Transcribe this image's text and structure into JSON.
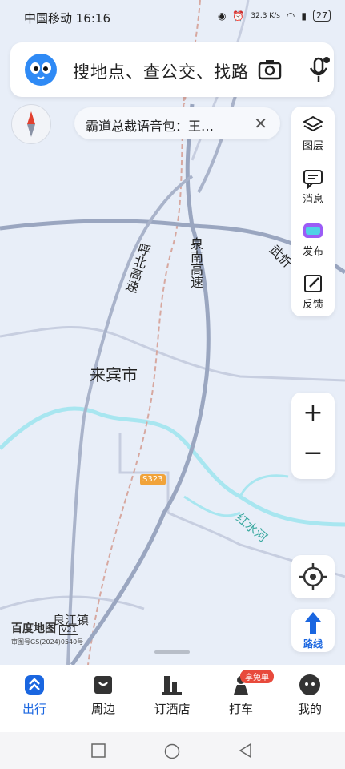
{
  "status": {
    "carrier_time": "中国移动 16:16",
    "net_speed": "32.3 K/s",
    "battery": "27"
  },
  "search": {
    "placeholder": "搜地点、查公交、找路"
  },
  "banner": {
    "text": "霸道总裁语音包：王…"
  },
  "side_tools": [
    {
      "label": "图层",
      "icon": "layers-icon"
    },
    {
      "label": "消息",
      "icon": "message-icon"
    },
    {
      "label": "发布",
      "icon": "publish-icon"
    },
    {
      "label": "反馈",
      "icon": "feedback-icon"
    }
  ],
  "map": {
    "labels": {
      "city": "来宾市",
      "highway_1": "呼北高速",
      "highway_2": "泉南高速",
      "highway_3": "武忻",
      "road_badge": "S323",
      "river": "红水河",
      "town": "良江镇"
    },
    "water_color": "#a8e6f0",
    "road_color": "#9aa6c0"
  },
  "route_label": "路线",
  "brand": {
    "name": "百度地图",
    "version": "V21",
    "review": "审图号GS(2024)0540号"
  },
  "tabs": [
    {
      "label": "出行",
      "active": true
    },
    {
      "label": "周边",
      "active": false
    },
    {
      "label": "订酒店",
      "active": false
    },
    {
      "label": "打车",
      "active": false
    },
    {
      "label": "我的",
      "active": false
    }
  ],
  "promo": "享免单",
  "accent": "#1a66e0"
}
